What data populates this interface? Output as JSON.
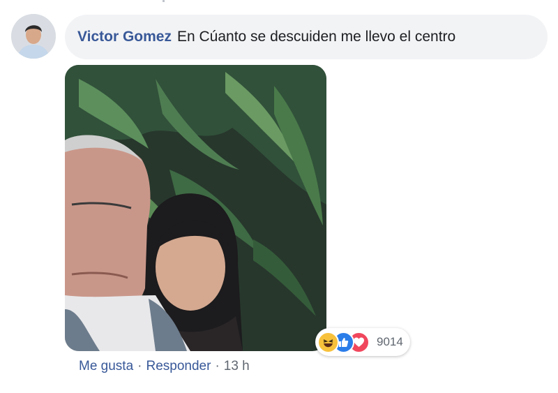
{
  "comment": {
    "author": "Victor Gomez",
    "text": "En Cúanto se descuiden me llevo el centro",
    "attachment_icon": "photo-attachment",
    "reactions": {
      "icons": [
        "haha-icon",
        "like-icon",
        "love-icon"
      ],
      "count": "9014"
    },
    "actions": {
      "like": "Me gusta",
      "separator": "·",
      "reply": "Responder",
      "time": "13 h"
    }
  },
  "colors": {
    "author": "#385898",
    "bubble": "#f2f3f5",
    "meta": "#606770",
    "like": "#2b7de9",
    "love": "#f0475d",
    "haha": "#f7c13b"
  }
}
